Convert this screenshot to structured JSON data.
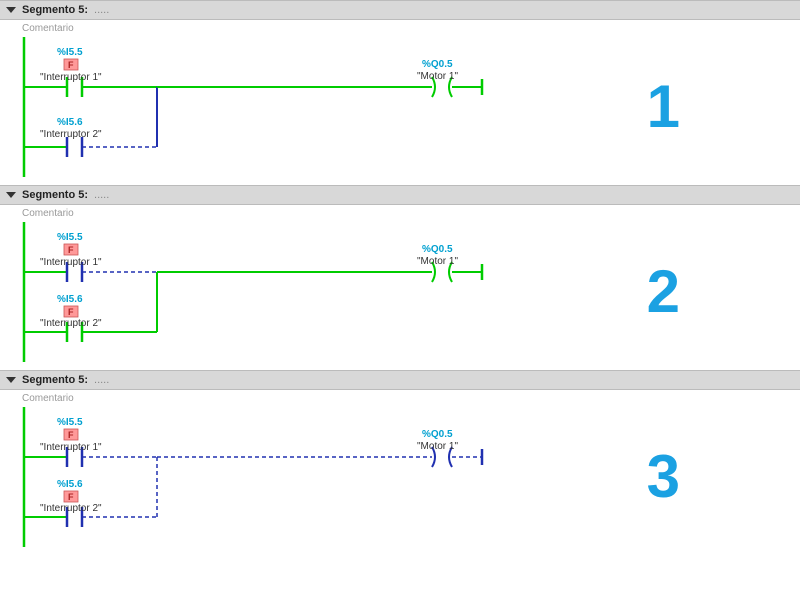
{
  "segments": [
    {
      "header": "Segmento 5:",
      "dots": ".....",
      "comment": "Comentario",
      "number": "1",
      "contact1": {
        "addr": "%I5.5",
        "name": "\"Interruptor 1\"",
        "force": "F",
        "state": "on"
      },
      "contact2": {
        "addr": "%I5.6",
        "name": "\"Interruptor 2\"",
        "force": null,
        "state": "off"
      },
      "coil": {
        "addr": "%Q0.5",
        "name": "\"Motor 1\"",
        "state": "on"
      },
      "mainwire": "on"
    },
    {
      "header": "Segmento 5:",
      "dots": ".....",
      "comment": "Comentario",
      "number": "2",
      "contact1": {
        "addr": "%I5.5",
        "name": "\"Interruptor 1\"",
        "force": "F",
        "state": "off"
      },
      "contact2": {
        "addr": "%I5.6",
        "name": "\"Interruptor 2\"",
        "force": "F",
        "state": "on"
      },
      "coil": {
        "addr": "%Q0.5",
        "name": "\"Motor 1\"",
        "state": "on"
      },
      "mainwire": "on"
    },
    {
      "header": "Segmento 5:",
      "dots": ".....",
      "comment": "Comentario",
      "number": "3",
      "contact1": {
        "addr": "%I5.5",
        "name": "\"Interruptor 1\"",
        "force": "F",
        "state": "off"
      },
      "contact2": {
        "addr": "%I5.6",
        "name": "\"Interruptor 2\"",
        "force": "F",
        "state": "off"
      },
      "coil": {
        "addr": "%Q0.5",
        "name": "\"Motor 1\"",
        "state": "off"
      },
      "mainwire": "off"
    }
  ]
}
